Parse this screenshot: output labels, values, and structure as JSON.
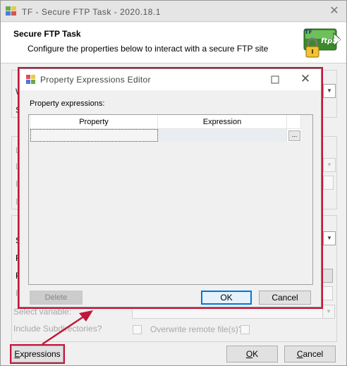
{
  "main_window": {
    "title": "TF - Secure FTP Task - 2020.18.1",
    "close_glyph": "✕",
    "icon": "ssis-task-icon"
  },
  "header": {
    "title": "Secure FTP Task",
    "description": "Configure the properties below to interact with a secure FTP site",
    "logo_text": "ftp://",
    "logo_badge": "TF",
    "logo_icon": "lock-ftp-logo"
  },
  "background_form": {
    "partial_labels": [
      "W",
      "S",
      "L",
      "L",
      "F",
      "I",
      "S",
      "R",
      "F",
      "F"
    ],
    "select_variable_label": "Select variable:",
    "include_subdirectories_label": "Include Subdirectories?",
    "overwrite_label": "Overwrite remote file(s)?"
  },
  "footer": {
    "expressions_label": "Expressions",
    "expressions_mnemonic": "E",
    "ok_label": "OK",
    "ok_mnemonic": "O",
    "cancel_label": "Cancel",
    "cancel_mnemonic": "C"
  },
  "dialog": {
    "title": "Property Expressions Editor",
    "close_glyph": "✕",
    "property_expressions_label": "Property expressions:",
    "columns": [
      "Property",
      "Expression"
    ],
    "rows": [
      {
        "property": "",
        "expression": ""
      }
    ],
    "ellipsis_label": "...",
    "delete_label": "Delete",
    "ok_label": "OK",
    "cancel_label": "Cancel"
  },
  "colors": {
    "highlight": "#c2163b",
    "focus_blue": "#0078d7"
  }
}
